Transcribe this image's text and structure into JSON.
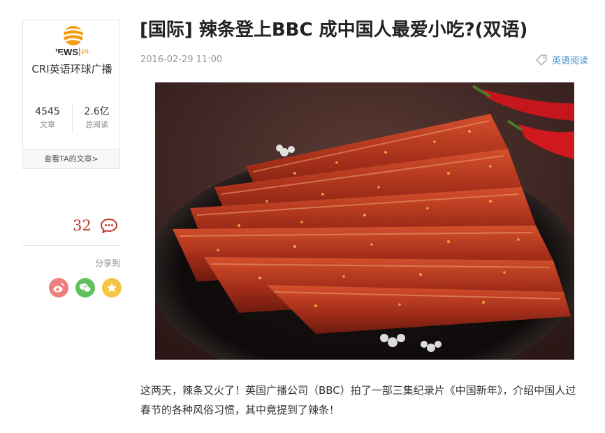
{
  "author": {
    "logo_text_main": "NEWS",
    "logo_text_plus": "Plus",
    "name": "CRI英语环球广播",
    "stats": [
      {
        "value": "4545",
        "label": "文章"
      },
      {
        "value": "2.6亿",
        "label": "总阅读"
      }
    ],
    "more_link": "查看TA的文章>"
  },
  "comments": {
    "count": "32"
  },
  "share": {
    "label": "分享到",
    "targets": [
      "weibo-icon",
      "wechat-icon",
      "qzone-icon"
    ],
    "colors": {
      "weibo": "#f08080",
      "wechat": "#5ec15e",
      "qzone": "#f5c542"
    }
  },
  "article": {
    "title": "[国际] 辣条登上BBC 成中国人最爱小吃?(双语)",
    "date": "2016-02-29 11:00",
    "en_read_label": "英语阅读",
    "paragraph": "这两天，辣条又火了！英国广播公司（BBC）拍了一部三集纪录片《中国新年》，介绍中国人过春节的各种风俗习惯，其中竟提到了辣条！"
  },
  "colors": {
    "accent_red": "#c0392b",
    "link_blue": "#3c8dc4",
    "logo_orange": "#f39c12"
  }
}
